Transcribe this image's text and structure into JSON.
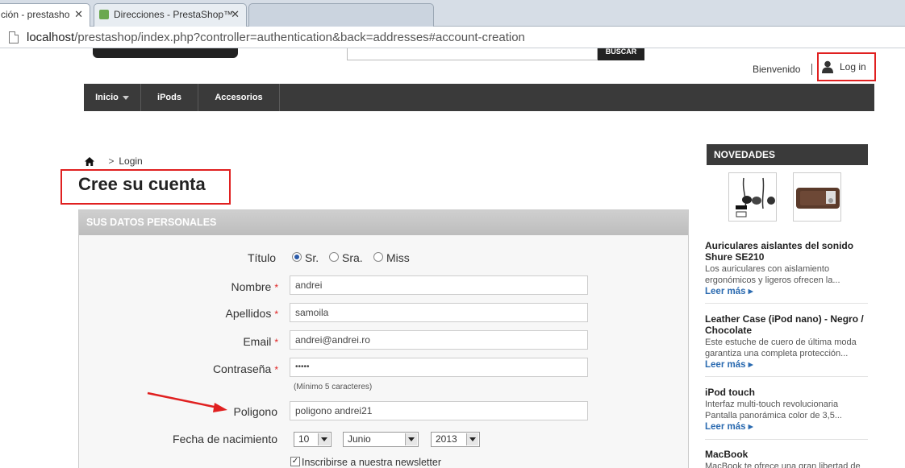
{
  "browser": {
    "tabs": [
      {
        "label": "ción - prestasho",
        "active": true
      },
      {
        "label": "Direcciones - PrestaShop™",
        "active": false
      },
      {
        "label": "",
        "active": false
      }
    ],
    "url_host": "localhost",
    "url_path": "/prestashop/index.php?controller=authentication&back=addresses#account-creation"
  },
  "header": {
    "search_button": "BUSCAR",
    "welcome": "Bienvenido",
    "login": "Log in"
  },
  "nav": {
    "items": [
      {
        "label": "Inicio"
      },
      {
        "label": "iPods"
      },
      {
        "label": "Accesorios"
      }
    ]
  },
  "breadcrumb": {
    "separator": ">",
    "current": "Login"
  },
  "page_title": "Cree su cuenta",
  "form": {
    "section_title": "SUS DATOS PERSONALES",
    "title_label": "Título",
    "title_options": [
      "Sr.",
      "Sra.",
      "Miss"
    ],
    "title_selected": "Sr.",
    "nombre_label": "Nombre",
    "nombre_value": "andrei",
    "apellidos_label": "Apellidos",
    "apellidos_value": "samoila",
    "email_label": "Email",
    "email_value": "andrei@andrei.ro",
    "password_label": "Contraseña",
    "password_value": "•••••",
    "password_hint": "(Mínimo 5 caracteres)",
    "poligono_label": "Poligono",
    "poligono_value": "poligono andrei21",
    "birth_label": "Fecha de nacimiento",
    "birth_day": "10",
    "birth_month": "Junio",
    "birth_year": "2013",
    "newsletter_label": "Inscribirse a nuestra newsletter",
    "required_mark": "*"
  },
  "sidebar": {
    "title": "NOVEDADES",
    "items": [
      {
        "title": "Auriculares aislantes del sonido Shure SE210",
        "desc": "Los auriculares con aislamiento ergonómicos y ligeros ofrecen la...",
        "more": "Leer más"
      },
      {
        "title": "Leather Case (iPod nano) - Negro / Chocolate",
        "desc": "Este estuche de cuero de última moda garantiza una completa protección...",
        "more": "Leer más"
      },
      {
        "title": "iPod touch",
        "desc": "Interfaz multi-touch revolucionaria Pantalla panorámica color de 3,5...",
        "more": "Leer más"
      },
      {
        "title": "MacBook",
        "desc": "MacBook te ofrece una gran libertad de",
        "more": ""
      }
    ]
  },
  "colors": {
    "annotation": "#e02020",
    "nav_bg": "#3a3a3a",
    "link": "#2a6ab0"
  }
}
